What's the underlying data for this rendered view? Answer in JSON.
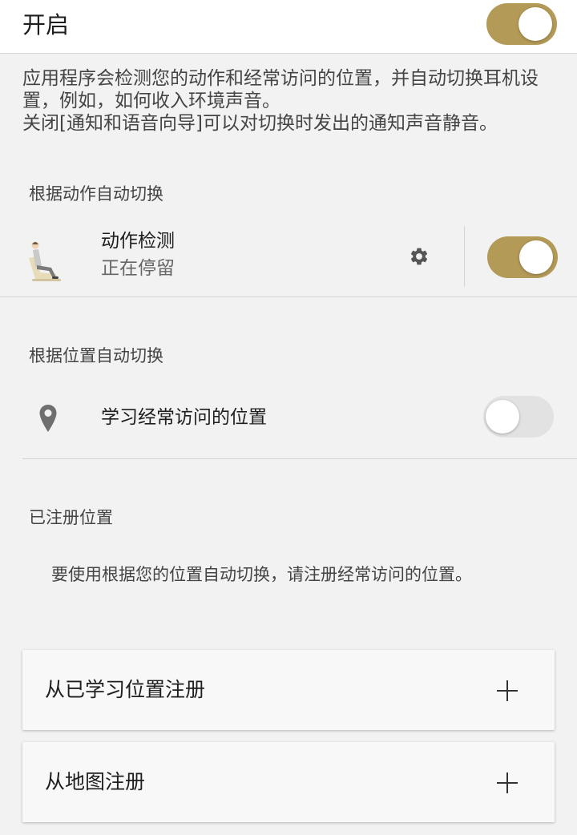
{
  "main_toggle": {
    "label": "开启",
    "state": "on"
  },
  "description": {
    "line1": "应用程序会检测您的动作和经常访问的位置，并自动切换耳机设置，例如，如何收入环境声音。",
    "line2": "关闭[通知和语音向导]可以对切换时发出的通知声音静音。"
  },
  "motion_section": {
    "header": "根据动作自动切换",
    "item": {
      "title": "动作检测",
      "subtitle": "正在停留",
      "icon": "sitting-person-icon",
      "settings_icon": "gear-icon",
      "toggle_state": "on"
    }
  },
  "location_section": {
    "header": "根据位置自动切换",
    "item": {
      "label": "学习经常访问的位置",
      "icon": "location-pin-icon",
      "toggle_state": "off"
    }
  },
  "registered_section": {
    "header": "已注册位置",
    "note": "要使用根据您的位置自动切换，请注册经常访问的位置。",
    "cards": [
      {
        "label": "从已学习位置注册",
        "icon": "plus-icon"
      },
      {
        "label": "从地图注册",
        "icon": "plus-icon"
      }
    ]
  },
  "colors": {
    "accent": "#b39a57",
    "toggle_off": "#e2e2e2",
    "background": "#f2f2f2"
  }
}
